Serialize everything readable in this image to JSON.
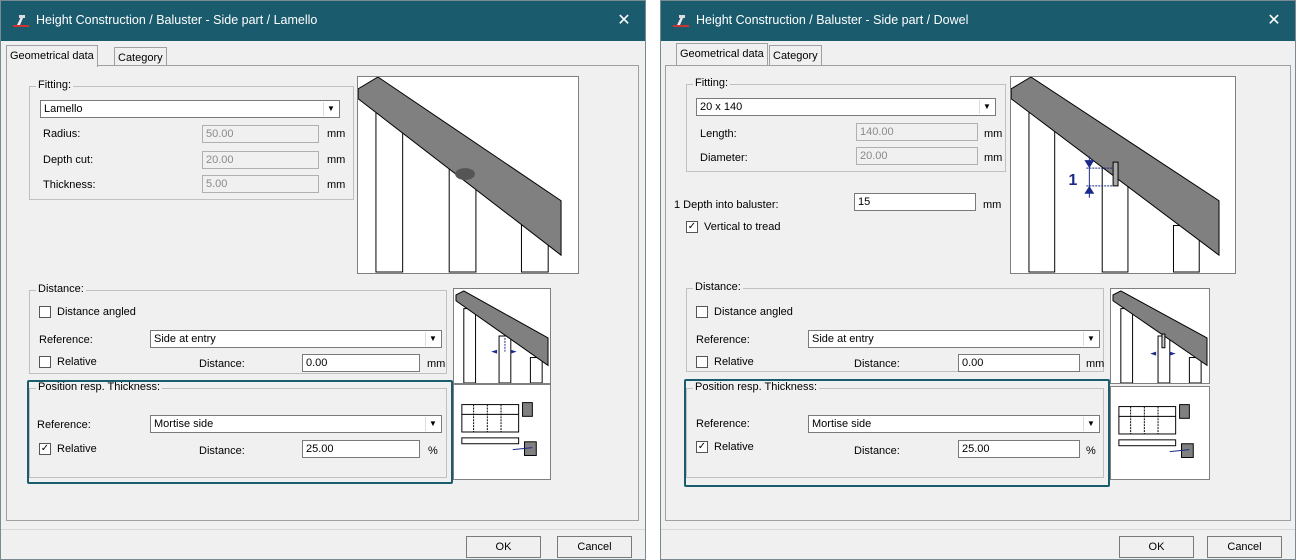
{
  "left": {
    "title": "Height Construction / Baluster - Side part / Lamello",
    "tabs": [
      "Geometrical data",
      "Category"
    ],
    "fitting": {
      "group": "Fitting:",
      "value": "Lamello",
      "radius_label": "Radius:",
      "radius_value": "50.00",
      "depth_label": "Depth cut:",
      "depth_value": "20.00",
      "thickness_label": "Thickness:",
      "thickness_value": "5.00",
      "unit": "mm"
    },
    "distance": {
      "group": "Distance:",
      "angled_label": "Distance angled",
      "reference_label": "Reference:",
      "reference_value": "Side at entry",
      "relative_label": "Relative",
      "distance_label": "Distance:",
      "distance_value": "0.00",
      "unit": "mm"
    },
    "position": {
      "group": "Position resp. Thickness:",
      "reference_label": "Reference:",
      "reference_value": "Mortise side",
      "relative_label": "Relative",
      "relative_checked": "✓",
      "distance_label": "Distance:",
      "distance_value": "25.00",
      "unit": "%"
    },
    "ok": "OK",
    "cancel": "Cancel"
  },
  "right": {
    "title": "Height Construction / Baluster - Side part / Dowel",
    "tabs": [
      "Geometrical data",
      "Category"
    ],
    "fitting": {
      "group": "Fitting:",
      "value": "20 x 140",
      "length_label": "Length:",
      "length_value": "140.00",
      "diameter_label": "Diameter:",
      "diameter_value": "20.00",
      "unit": "mm"
    },
    "depth_into_label": "1 Depth into baluster:",
    "depth_into_value": "15",
    "depth_into_unit": "mm",
    "vertical_label": "Vertical to tread",
    "vertical_checked": "✓",
    "figure_marker": "1",
    "distance": {
      "group": "Distance:",
      "angled_label": "Distance angled",
      "reference_label": "Reference:",
      "reference_value": "Side at entry",
      "relative_label": "Relative",
      "distance_label": "Distance:",
      "distance_value": "0.00",
      "unit": "mm"
    },
    "position": {
      "group": "Position resp. Thickness:",
      "reference_label": "Reference:",
      "reference_value": "Mortise side",
      "relative_label": "Relative",
      "relative_checked": "✓",
      "distance_label": "Distance:",
      "distance_value": "25.00",
      "unit": "%"
    },
    "ok": "OK",
    "cancel": "Cancel"
  }
}
